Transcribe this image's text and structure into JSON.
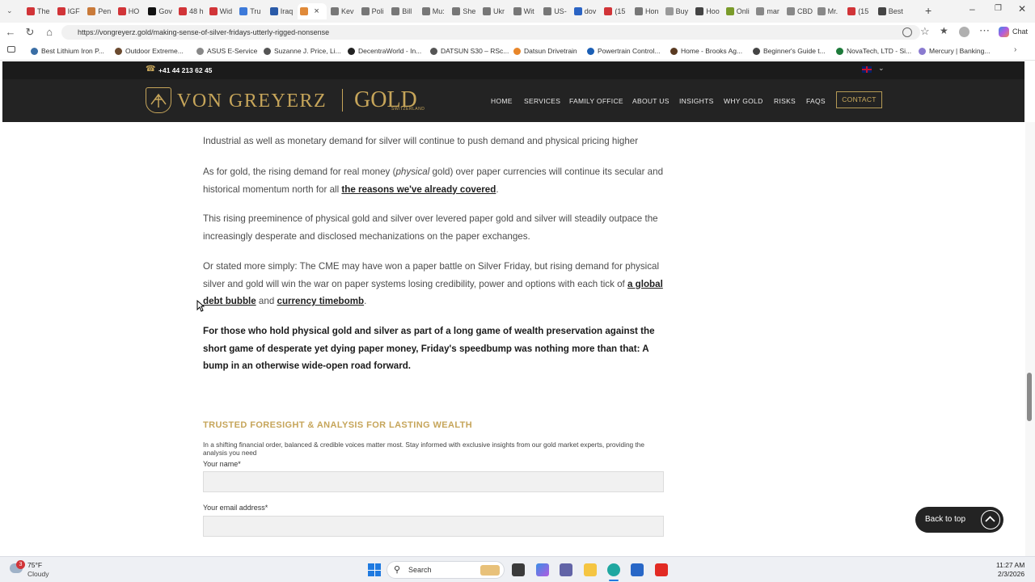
{
  "browser": {
    "tabs": [
      "The",
      "IGF",
      "Pen",
      "HO",
      "Gov",
      "48 h",
      "Wid",
      "Tru",
      "Iraq",
      "",
      "Kev",
      "Poli",
      "Bill",
      "Mu:",
      "She",
      "Ukr",
      "Wit",
      "US-",
      "dov",
      "(15",
      "Hon",
      "Buy",
      "Hoo",
      "Onli",
      "mar",
      "CBD",
      "Mr.",
      "(15",
      "Best"
    ],
    "url": "https://vongreyerz.gold/making-sense-of-silver-fridays-utterly-rigged-nonsense",
    "copilot_label": "Chat",
    "bookmarks": [
      "Best Lithium Iron P...",
      "Outdoor Extreme...",
      "ASUS E-Service",
      "Suzanne J. Price, Li...",
      "DecentraWorld - In...",
      "DATSUN S30 – RSc...",
      "Datsun Drivetrain",
      "Powertrain Control...",
      "Home - Brooks Ag...",
      "Beginner's Guide t...",
      "NovaTech, LTD - Si...",
      "Mercury | Banking..."
    ]
  },
  "site": {
    "phone": "+41 44 213 62 45",
    "logo_main": "VON GREYERZ",
    "logo_gold": "GOLD",
    "logo_sub": "SWITZERLAND",
    "nav": [
      "HOME",
      "SERVICES",
      "FAMILY OFFICE",
      "ABOUT US",
      "INSIGHTS",
      "WHY GOLD",
      "RISKS",
      "FAQS"
    ],
    "contact": "CONTACT"
  },
  "article": {
    "p1": "Industrial as well as monetary demand for silver will continue to push demand and physical pricing higher",
    "p2_a": "As for gold, the rising demand for real money (",
    "p2_em": "physical",
    "p2_b": " gold) over paper currencies will continue its secular and historical momentum north for all ",
    "p2_link": "the reasons we've already covered",
    "p2_c": ".",
    "p3": "This rising preeminence of physical gold and silver over levered paper gold and silver will steadily outpace the increasingly desperate and disclosed mechanizations on the paper exchanges.",
    "p4_a": "Or stated more simply: The CME may have won a paper battle on Silver Friday, but rising demand for physical silver and gold will win the war on paper systems losing credibility, power and options with each tick of ",
    "p4_link1": "a global debt bubble",
    "p4_b": " and ",
    "p4_link2": "currency timebomb",
    "p4_c": ".",
    "p5": "For those who hold physical gold and silver as part of a long game of wealth preservation against the short game of desperate yet dying paper money, Friday's speedbump was nothing more than that: A bump in an otherwise wide-open road forward."
  },
  "form": {
    "heading": "TRUSTED FORESIGHT & ANALYSIS FOR LASTING WEALTH",
    "subtext": "In a shifting financial order, balanced & credible voices matter most. Stay informed with exclusive insights from our gold market experts, providing the analysis you need",
    "name_label": "Your name*",
    "email_label": "Your email address*"
  },
  "back_to_top": "Back to top",
  "taskbar": {
    "weather_temp": "75°F",
    "weather_cond": "Cloudy",
    "search": "Search",
    "time": "11:27 AM",
    "date": "2/3/2026",
    "notif_count": "3"
  }
}
